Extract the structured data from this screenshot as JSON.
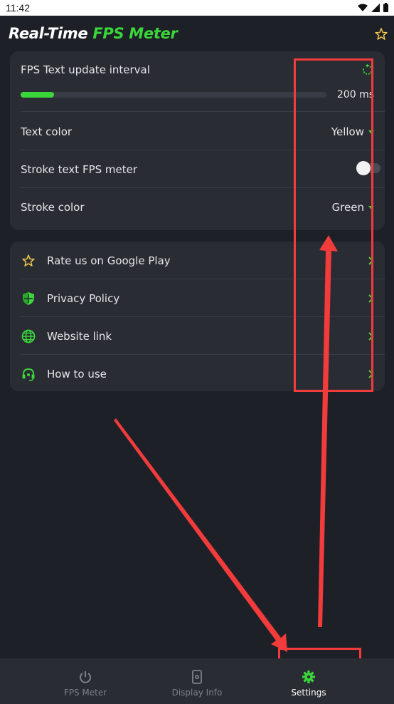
{
  "status_bar": {
    "time": "11:42"
  },
  "header": {
    "title_prefix": "Real-Time ",
    "title_accent": "FPS Meter"
  },
  "settings": {
    "interval_label": "FPS Text update interval",
    "interval_value": "200 ms",
    "interval_fraction": 0.11,
    "text_color_label": "Text color",
    "text_color_value": "Yellow",
    "stroke_label": "Stroke text FPS meter",
    "stroke_enabled": false,
    "stroke_color_label": "Stroke color",
    "stroke_color_value": "Green"
  },
  "links": [
    {
      "label": "Rate us on Google Play",
      "icon": "star-icon"
    },
    {
      "label": "Privacy Policy",
      "icon": "shield-icon"
    },
    {
      "label": "Website link",
      "icon": "globe-icon"
    },
    {
      "label": "How to use",
      "icon": "headset-icon"
    }
  ],
  "bottom_nav": [
    {
      "label": "FPS Meter",
      "icon": "power-icon",
      "active": false
    },
    {
      "label": "Display Info",
      "icon": "phone-gear-icon",
      "active": false
    },
    {
      "label": "Settings",
      "icon": "gear-icon",
      "active": true
    }
  ],
  "colors": {
    "accent": "#3ad63a",
    "background": "#1e2028",
    "card": "#2a2c34",
    "annotation": "#f23b3b",
    "star": "#f2c94c"
  }
}
